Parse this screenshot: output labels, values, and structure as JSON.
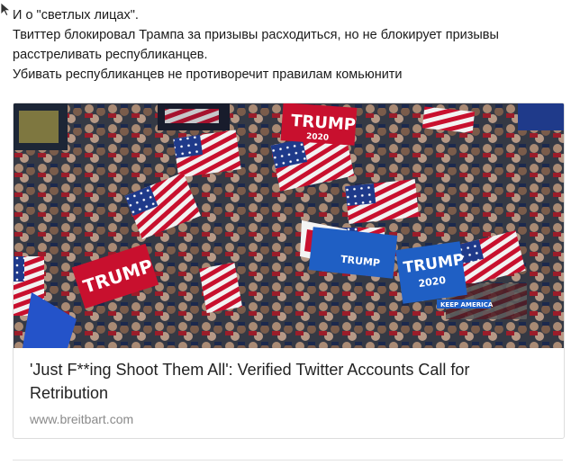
{
  "post": {
    "lines": [
      "И о \"светлых лицах\".",
      "Твиттер блокировал Трампа за призывы расходиться, но не блокирует призывы расстреливать республиканцев.",
      "Убивать республиканцев не противоречит правилам комьюнити"
    ]
  },
  "link_preview": {
    "title": "'Just F**ing Shoot Them All': Verified Twitter Accounts Call for Retribution",
    "domain": "www.breitbart.com",
    "image_icon": "crowd-rally-photo",
    "image_signs": {
      "sign_1": "TRUMP",
      "sign_1_sub": "2020",
      "sign_2": "TRUMP",
      "sign_3": "TRUMP",
      "sign_3_sub": "2020",
      "sign_4": "TRUMP",
      "sign_5": "KEEP AMERICA"
    }
  },
  "colors": {
    "text": "#222222",
    "domain": "#8a8a8a",
    "border": "#dddddd"
  }
}
